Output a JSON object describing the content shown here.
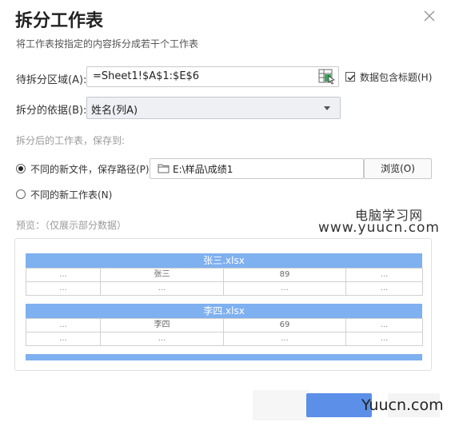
{
  "dialog": {
    "title": "拆分工作表",
    "subtitle": "将工作表按指定的内容拆分成若干个工作表"
  },
  "range": {
    "label": "待拆分区域(A):",
    "value": "=Sheet1!$A$1:$E$6",
    "icon": "range-select-icon"
  },
  "header_checkbox": {
    "label": "数据包含标题(H)",
    "checked": true
  },
  "split_by": {
    "label": "拆分的依据(B):",
    "selected": "姓名(列A)"
  },
  "save_section": {
    "label": "拆分后的工作表，保存到:",
    "option_new_file": "不同的新文件，保存路径(P)",
    "option_new_sheet": "不同的新工作表(N)",
    "selected": "new_file",
    "path": "E:\\样品\\成绩1",
    "browse_label": "浏览(O)"
  },
  "watermark": {
    "line1": "电脑学习网",
    "line2": "www.yuucn.com",
    "bottom": "Yuucn.com"
  },
  "preview": {
    "label": "预览：（仅展示部分数据）",
    "files": [
      {
        "name": "张三.xlsx",
        "rows": [
          [
            "...",
            "张三",
            "89",
            "..."
          ],
          [
            "...",
            "...",
            "...",
            "..."
          ]
        ]
      },
      {
        "name": "李四.xlsx",
        "rows": [
          [
            "...",
            "李四",
            "69",
            "..."
          ],
          [
            "...",
            "...",
            "...",
            "..."
          ]
        ]
      }
    ]
  },
  "colors": {
    "accent": "#7fb0f0",
    "ok_button": "#5b8fe8"
  }
}
